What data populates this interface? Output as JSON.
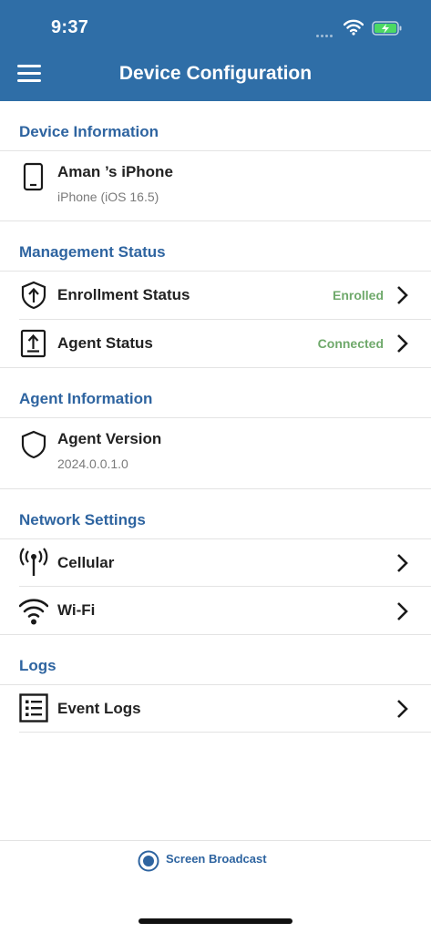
{
  "status_bar": {
    "time": "9:37"
  },
  "header": {
    "title": "Device Configuration"
  },
  "sections": {
    "device_information": {
      "title": "Device Information",
      "device_name": "Aman ’s iPhone",
      "device_model": "iPhone (iOS 16.5)"
    },
    "management_status": {
      "title": "Management Status",
      "enrollment_label": "Enrollment Status",
      "enrollment_value": "Enrolled",
      "agent_label": "Agent Status",
      "agent_value": "Connected"
    },
    "agent_information": {
      "title": "Agent Information",
      "version_label": "Agent Version",
      "version_value": "2024.0.0.1.0"
    },
    "network_settings": {
      "title": "Network Settings",
      "cellular_label": "Cellular",
      "wifi_label": "Wi-Fi"
    },
    "logs": {
      "title": "Logs",
      "event_logs_label": "Event Logs"
    }
  },
  "footer": {
    "broadcast_label": "Screen Broadcast"
  },
  "colors": {
    "header_bg": "#2f6ea7",
    "section_title": "#2e64a0",
    "status_value": "#6fa96b",
    "battery_fill": "#4cd964"
  },
  "icons": [
    "menu-icon",
    "phone-icon",
    "shield-arrow-icon",
    "upload-box-icon",
    "shield-icon",
    "antenna-icon",
    "wifi-icon",
    "list-icon",
    "chevron-right-icon",
    "record-icon"
  ]
}
